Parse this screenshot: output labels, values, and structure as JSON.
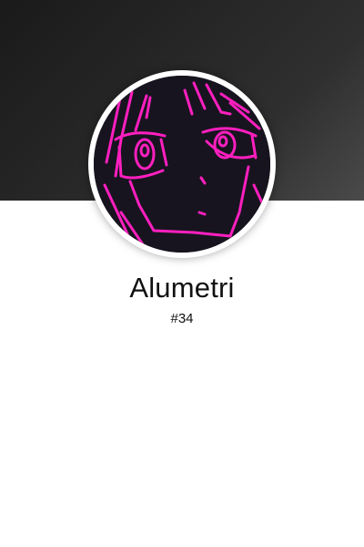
{
  "profile": {
    "name": "Alumetri",
    "rank": "#34",
    "avatar_icon": "anime-character-sketch-avatar",
    "accent_color": "#ff1fbf"
  }
}
